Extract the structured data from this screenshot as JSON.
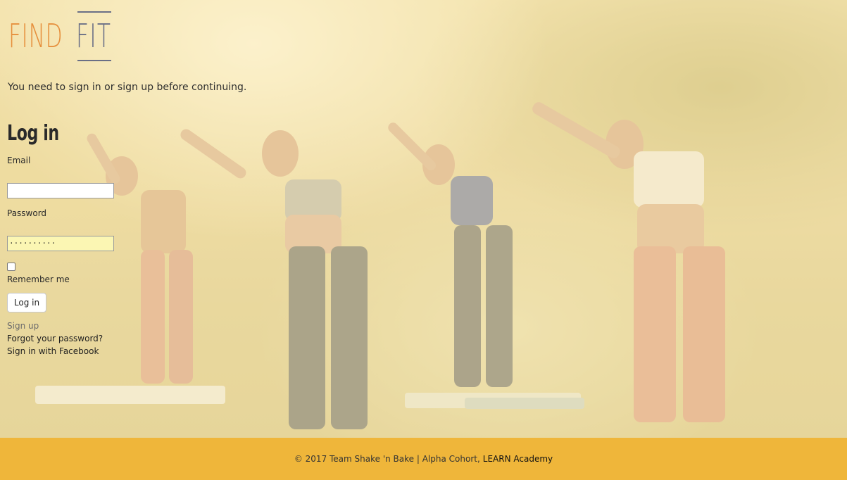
{
  "logo": {
    "find": "FIND",
    "fit": "FIT"
  },
  "notice": "You need to sign in or sign up before continuing.",
  "form": {
    "title": "Log in",
    "email_label": "Email",
    "email_value": "",
    "password_label": "Password",
    "password_value": "··········",
    "remember_label": "Remember me",
    "submit_label": "Log in"
  },
  "links": {
    "sign_up": "Sign up",
    "forgot": "Forgot your password?",
    "facebook": "Sign in with Facebook"
  },
  "footer": {
    "text": "© 2017 Team Shake 'n Bake | Alpha Cohort,",
    "academy": "LEARN Academy"
  },
  "colors": {
    "footer_bg": "#efb63a",
    "logo_find": "#e6903d",
    "logo_fit": "#6a6f86"
  }
}
